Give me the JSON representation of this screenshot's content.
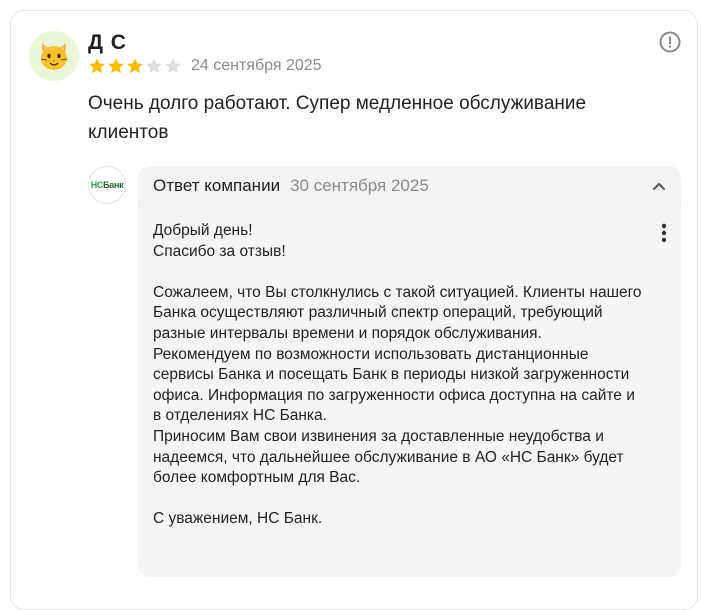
{
  "review": {
    "author": "Д С",
    "rating": 3,
    "max_rating": 5,
    "date": "24 сентября 2025",
    "text": "Очень долго работают. Супер медленное обслуживание клиентов",
    "avatar_icon": "cat-face-emoji",
    "report_icon": "exclamation-circle-icon",
    "star_color": "#fdbc00",
    "star_empty_color": "#dedede"
  },
  "reply": {
    "logo_text_green": "НС",
    "logo_text_dark": "Банк",
    "title": "Ответ компании",
    "date": "30 сентября 2025",
    "collapse_icon": "chevron-up-icon",
    "menu_icon": "more-vertical-icon",
    "text": "Добрый день!\nСпасибо за отзыв!\n\nСожалеем, что Вы столкнулись с такой ситуацией. Клиенты нашего Банка осуществляют различный спектр операций, требующий разные интервалы времени и порядок обслуживания.\nРекомендуем по возможности использовать дистанционные сервисы Банка и посещать Банк в периоды низкой загруженности офиса. Информация по загруженности офиса доступна на сайте и в отделениях НС Банка.\nПриносим Вам свои извинения за доставленные неудобства и надеемся, что дальнейшее обслуживание в АО «НС Банк» будет более комфортным для Вас.\n\nС уважением, НС Банк."
  }
}
